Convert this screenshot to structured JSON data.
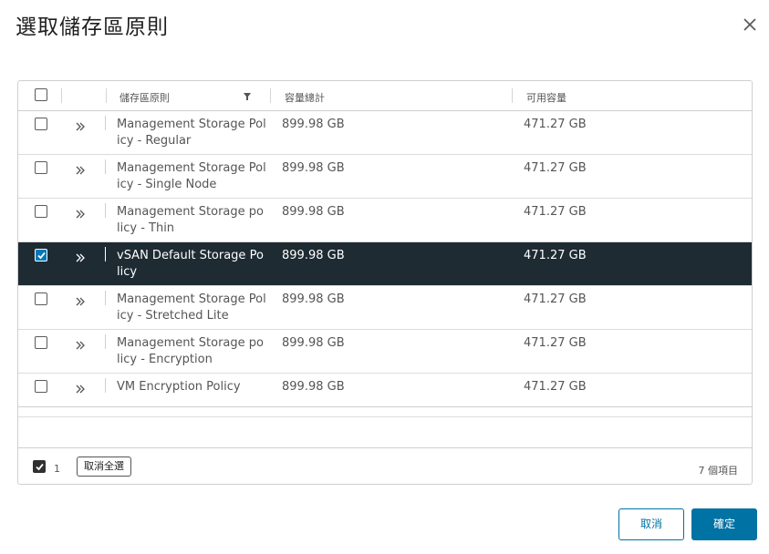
{
  "dialog": {
    "title": "選取儲存區原則"
  },
  "columns": {
    "policy": "儲存區原則",
    "total": "容量總計",
    "free": "可用容量"
  },
  "rows": [
    {
      "name": "Management Storage Policy - Regular",
      "total": "899.98 GB",
      "free": "471.27 GB",
      "checked": false
    },
    {
      "name": "Management Storage Policy - Single Node",
      "total": "899.98 GB",
      "free": "471.27 GB",
      "checked": false
    },
    {
      "name": "Management Storage policy - Thin",
      "total": "899.98 GB",
      "free": "471.27 GB",
      "checked": false
    },
    {
      "name": "vSAN Default Storage Policy",
      "total": "899.98 GB",
      "free": "471.27 GB",
      "checked": true
    },
    {
      "name": "Management Storage Policy - Stretched Lite",
      "total": "899.98 GB",
      "free": "471.27 GB",
      "checked": false
    },
    {
      "name": "Management Storage policy - Encryption",
      "total": "899.98 GB",
      "free": "471.27 GB",
      "checked": false
    },
    {
      "name": "VM Encryption Policy",
      "total": "899.98 GB",
      "free": "471.27 GB",
      "checked": false
    }
  ],
  "footer": {
    "selected_count": "1",
    "clear_all": "取消全選",
    "items": "7 個項目"
  },
  "actions": {
    "cancel": "取消",
    "ok": "確定"
  },
  "colors": {
    "accent": "#0072a3",
    "selected_row": "#1e2b33"
  },
  "icons": {
    "close": "close-icon",
    "filter": "filter-icon",
    "expand": "double-chevron-right-icon",
    "check": "check-icon"
  }
}
